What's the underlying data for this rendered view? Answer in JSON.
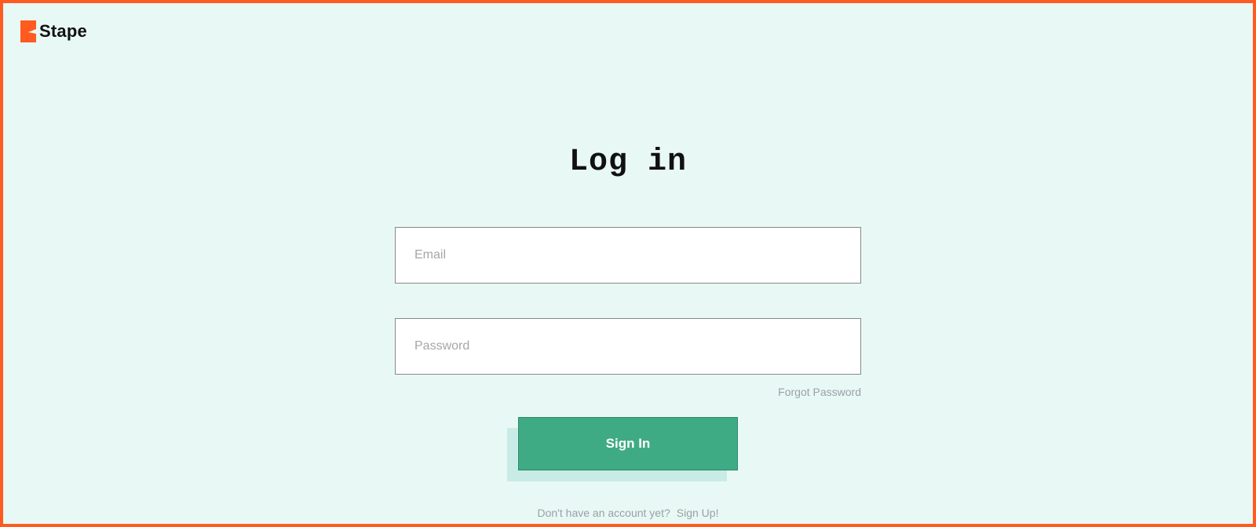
{
  "brand": {
    "name": "Stape"
  },
  "login": {
    "heading": "Log in",
    "email_placeholder": "Email",
    "password_placeholder": "Password",
    "forgot_label": "Forgot Password",
    "signin_label": "Sign In",
    "signup_prompt": "Don't have an account yet?",
    "signup_link": "Sign Up!"
  },
  "colors": {
    "accent": "#ff5a1f",
    "bg_tint": "#e8f8f5",
    "button": "#3fab84"
  }
}
